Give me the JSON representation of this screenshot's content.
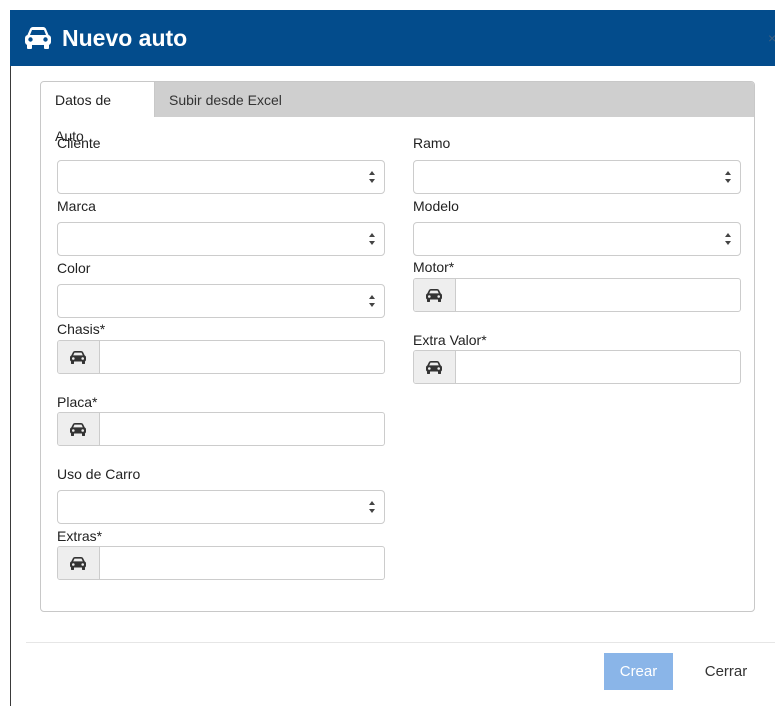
{
  "dialog": {
    "title": "Nuevo auto",
    "close_glyph": "×",
    "icon": "car-icon"
  },
  "tabs": [
    {
      "label": "Datos de Auto",
      "active": true
    },
    {
      "label": "Subir desde Excel",
      "active": false
    }
  ],
  "form": {
    "cliente": {
      "label": "Cliente",
      "value": ""
    },
    "ramo": {
      "label": "Ramo",
      "value": ""
    },
    "marca": {
      "label": "Marca",
      "value": ""
    },
    "modelo": {
      "label": "Modelo",
      "value": ""
    },
    "color": {
      "label": "Color",
      "value": ""
    },
    "motor": {
      "label": "Motor*",
      "value": "",
      "icon": "car-icon"
    },
    "chasis": {
      "label": "Chasis*",
      "value": "",
      "icon": "car-icon"
    },
    "extra_valor": {
      "label": "Extra Valor*",
      "value": "",
      "icon": "car-icon"
    },
    "placa": {
      "label": "Placa*",
      "value": "",
      "icon": "car-icon"
    },
    "uso_de_carro": {
      "label": "Uso de Carro",
      "value": ""
    },
    "extras": {
      "label": "Extras*",
      "value": "",
      "icon": "car-icon"
    }
  },
  "footer": {
    "create_label": "Crear",
    "close_label": "Cerrar"
  },
  "colors": {
    "header_bg": "#034c8c",
    "primary_button": "#8ab5e8",
    "tabbar_bg": "#cfcfcf"
  }
}
